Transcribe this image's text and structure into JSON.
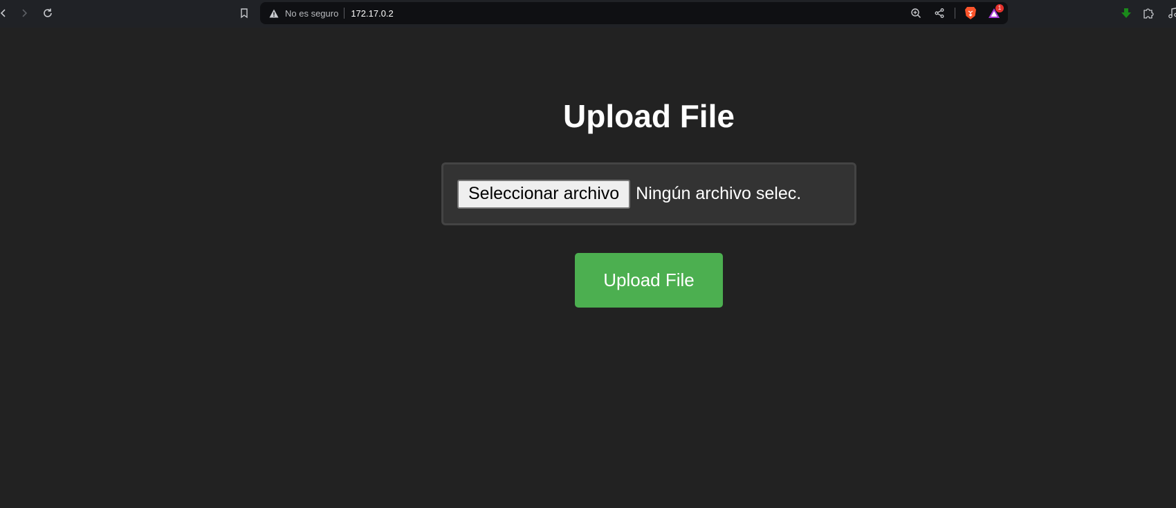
{
  "browser": {
    "security_label": "No es seguro",
    "url": "172.17.0.2",
    "notification_count": "1",
    "icons": {
      "back": "chevron-left-icon",
      "forward": "chevron-right-icon",
      "reload": "reload-icon",
      "bookmark": "bookmark-icon",
      "warning": "warning-triangle-icon",
      "zoom": "zoom-in-icon",
      "share": "share-icon",
      "brave_shields": "brave-lion-icon",
      "brave_rewards": "rewards-triangle-icon",
      "download": "download-arrow-icon",
      "extensions": "puzzle-icon",
      "media": "music-note-icon"
    },
    "colors": {
      "download_icon": "#1a8a1a",
      "brave_icon": "#fb542b",
      "badge": "#e5322d"
    }
  },
  "page": {
    "title": "Upload File",
    "file_input": {
      "button_label": "Seleccionar archivo",
      "status_text": "Ningún archivo selec."
    },
    "submit_label": "Upload File",
    "colors": {
      "background": "#222222",
      "form_background": "#333333",
      "submit_button": "#4caf50"
    }
  }
}
